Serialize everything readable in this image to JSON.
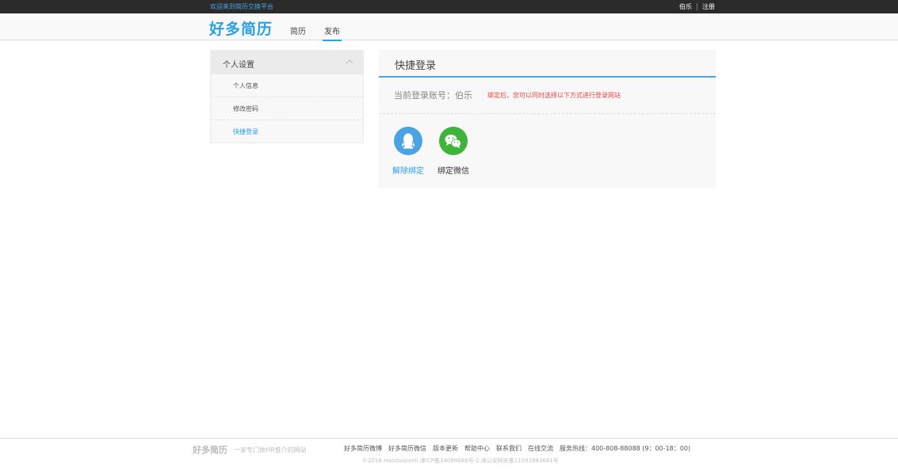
{
  "topbar": {
    "welcome": "欢迎来到简历交换平台",
    "user": "伯乐",
    "register": "注册"
  },
  "header": {
    "logo": "好多简历",
    "nav": [
      "简历",
      "发布"
    ],
    "active_nav": "发布"
  },
  "sidebar": {
    "title": "个人设置",
    "items": [
      {
        "label": "个人信息"
      },
      {
        "label": "修改密码"
      },
      {
        "label": "快捷登录"
      }
    ],
    "active_item": "快捷登录"
  },
  "panel": {
    "title": "快捷登录",
    "account_label": "当前登录账号：伯乐",
    "tip": "绑定后，您可以同时选择以下方式进行登录网站",
    "bindings": [
      {
        "icon": "qq-icon",
        "label": "解除绑定",
        "color": "#4ba3e4"
      },
      {
        "icon": "wechat-icon",
        "label": "绑定微信",
        "color": "#3eb53a"
      }
    ]
  },
  "footer": {
    "logo": "好多简历",
    "slogan": "· 一家专门做HR推介的网站",
    "links": [
      "好多简历微博",
      "好多简历微信",
      "版本更新",
      "帮助中心",
      "联系我们",
      "在线交流",
      "服务热线：400-808-88088 (9：00-18：00)"
    ],
    "copyright": "©2016 Haoduojianli 津ICP备14088688号-2 津公安网安备11091883681号"
  },
  "colors": {
    "accent": "#2aa0e8",
    "topbar_bg": "#2b2b2b",
    "tip_red": "#e64545",
    "qq_blue": "#4ba3e4",
    "wechat_green": "#3eb53a"
  }
}
